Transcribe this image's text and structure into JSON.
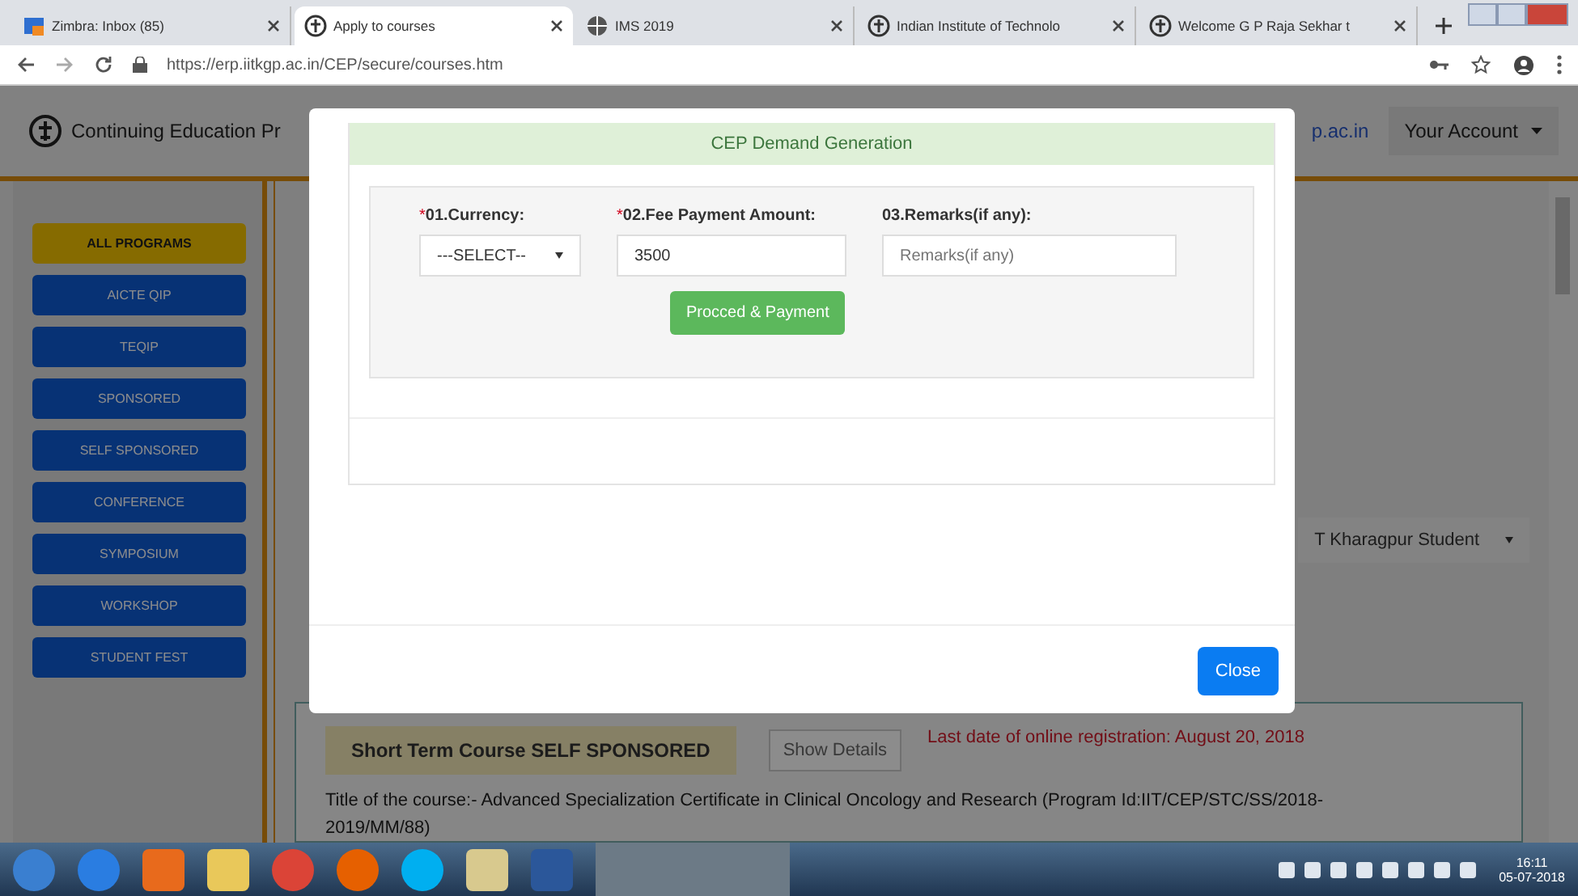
{
  "browser": {
    "tabs": [
      {
        "title": "Zimbra: Inbox (85)",
        "selected": false,
        "kind": "mail"
      },
      {
        "title": "Apply to courses",
        "selected": true,
        "kind": "emblem"
      },
      {
        "title": "IMS 2019",
        "selected": false,
        "kind": "globe"
      },
      {
        "title": "Indian Institute of Technolo",
        "selected": false,
        "kind": "emblem"
      },
      {
        "title": "Welcome G P Raja Sekhar t",
        "selected": false,
        "kind": "emblem"
      }
    ],
    "address": "https://erp.iitkgp.ac.in/CEP/secure/courses.htm"
  },
  "header": {
    "title_visible": "Continuing Education Pr",
    "email_visible": "p.ac.in",
    "account_button": "Your Account"
  },
  "sidebar": {
    "items": [
      {
        "label": "ALL PROGRAMS",
        "selected": true
      },
      {
        "label": "AICTE QIP",
        "selected": false
      },
      {
        "label": "TEQIP",
        "selected": false
      },
      {
        "label": "SPONSORED",
        "selected": false
      },
      {
        "label": "SELF SPONSORED",
        "selected": false
      },
      {
        "label": "CONFERENCE",
        "selected": false
      },
      {
        "label": "SYMPOSIUM",
        "selected": false
      },
      {
        "label": "WORKSHOP",
        "selected": false
      },
      {
        "label": "STUDENT FEST",
        "selected": false
      }
    ]
  },
  "user_type_select": {
    "value": "T Kharagpur Student"
  },
  "course_card": {
    "badge": "Short Term Course SELF SPONSORED",
    "details_button": "Show Details",
    "deadline": "Last date of online registration: August 20, 2018",
    "description": "Title of the course:- Advanced Specialization Certificate in Clinical Oncology and Research (Program Id:IIT/CEP/STC/SS/2018-2019/MM/88)"
  },
  "modal": {
    "title": "CEP Demand Generation",
    "required_mark": "*",
    "fields": [
      {
        "label": "01.Currency:",
        "required": true,
        "kind": "select",
        "value": "---SELECT--"
      },
      {
        "label": "02.Fee Payment Amount:",
        "required": true,
        "kind": "text",
        "value": "3500"
      },
      {
        "label": "03.Remarks(if any):",
        "required": false,
        "kind": "textarea",
        "placeholder": "Remarks(if any)"
      }
    ],
    "submit_button": "Procced & Payment",
    "close_button": "Close"
  },
  "taskbar": {
    "time": "16:11",
    "date": "05-07-2018"
  }
}
